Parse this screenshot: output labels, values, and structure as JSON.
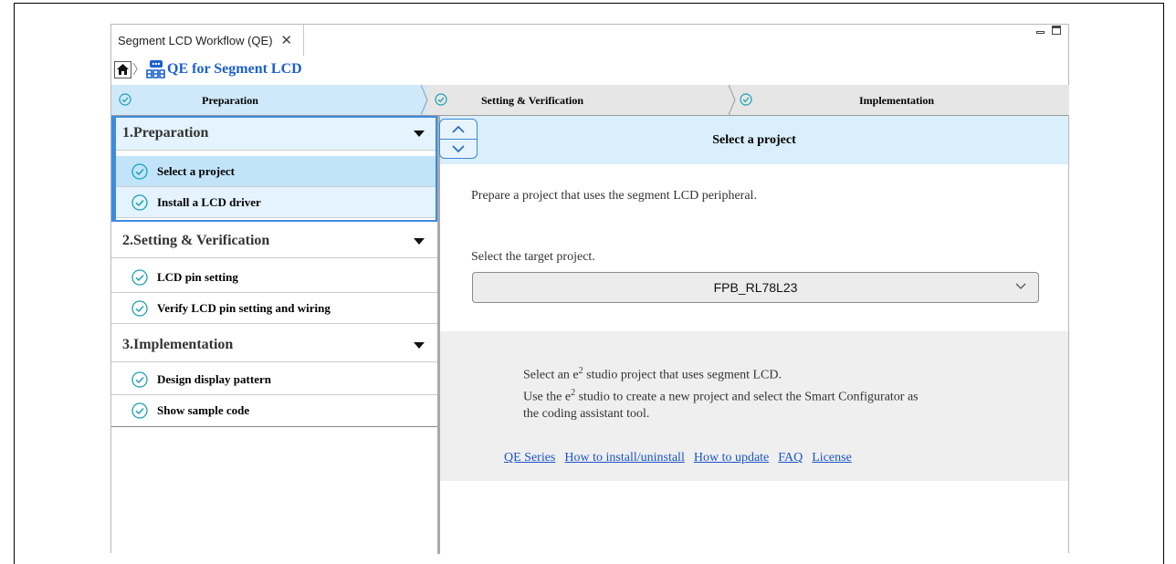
{
  "view_tab": {
    "title": "Segment LCD Workflow (QE)",
    "close": "✕"
  },
  "breadcrumb": {
    "separator": "〉",
    "title": "QE for Segment LCD"
  },
  "stepper": {
    "steps": [
      {
        "label": "Preparation"
      },
      {
        "label": "Setting & Verification"
      },
      {
        "label": "Implementation"
      }
    ]
  },
  "sidebar": {
    "sections": [
      {
        "title": "1.Preparation",
        "items": [
          "Select a project",
          "Install a LCD driver"
        ]
      },
      {
        "title": "2.Setting & Verification",
        "items": [
          "LCD pin setting",
          "Verify LCD pin setting and wiring"
        ]
      },
      {
        "title": "3.Implementation",
        "items": [
          "Design display pattern",
          "Show sample code"
        ]
      }
    ]
  },
  "main": {
    "header": "Select a project",
    "description": "Prepare a project that uses the segment LCD peripheral.",
    "target_label": "Select the target project.",
    "project_value": "FPB_RL78L23",
    "info_line1_pre": "Select an e",
    "info_line1_sup": "2",
    "info_line1_post": " studio project that uses segment LCD.",
    "info_line2_pre": "Use the e",
    "info_line2_sup": "2",
    "info_line2_post": " studio to create a new project and select the Smart Configurator as",
    "info_line3": "the coding assistant tool.",
    "links": [
      "QE Series",
      "How to install/uninstall",
      "How to update",
      "FAQ",
      "License"
    ]
  },
  "colors": {
    "accent": "#3c8be0",
    "link": "#1a55c5",
    "active_step": "#cfe9fb",
    "check": "#1aa0b3"
  }
}
